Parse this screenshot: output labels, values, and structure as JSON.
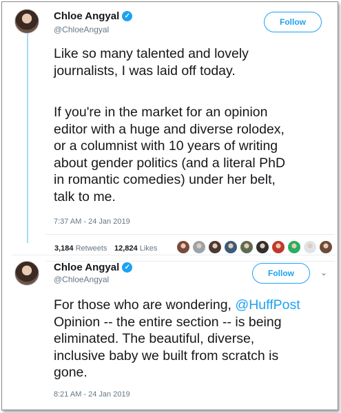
{
  "tweet1": {
    "name": "Chloe Angyal",
    "handle": "@ChloeAngyal",
    "follow_label": "Follow",
    "text_p1": "Like so many talented and lovely\njournalists, I was laid off today.",
    "text_p2": "If you're in the market for an opinion\neditor with a huge and diverse rolodex,\nor a columnist with 10 years of writing\nabout gender politics (and a literal PhD\nin romantic comedies) under her belt,\ntalk to me.",
    "timestamp": "7:37 AM - 24 Jan 2019",
    "retweets_count": "3,184",
    "retweets_label": "Retweets",
    "likes_count": "12,824",
    "likes_label": "Likes",
    "liker_avatars": [
      "#7b4a3a",
      "#9aa3ab",
      "#4b3a33",
      "#3c5a7a",
      "#5e6b52",
      "#2f2f2f",
      "#c0392b",
      "#27ae60",
      "#dfe4ea",
      "#6b4c3b"
    ]
  },
  "tweet2": {
    "name": "Chloe Angyal",
    "handle": "@ChloeAngyal",
    "follow_label": "Follow",
    "chevron": "⌄",
    "text_before": "For those who are wondering, ",
    "mention": "@HuffPost",
    "text_after": "\nOpinion -- the entire section -- is being\neliminated. The beautiful, diverse,\ninclusive baby we built from scratch is\ngone.",
    "timestamp": "8:21 AM - 24 Jan 2019"
  },
  "colors": {
    "accent": "#1da1f2",
    "thread_line": "#a3d9f7",
    "secondary_text": "#657786"
  },
  "icons": {
    "verified": "✓"
  }
}
